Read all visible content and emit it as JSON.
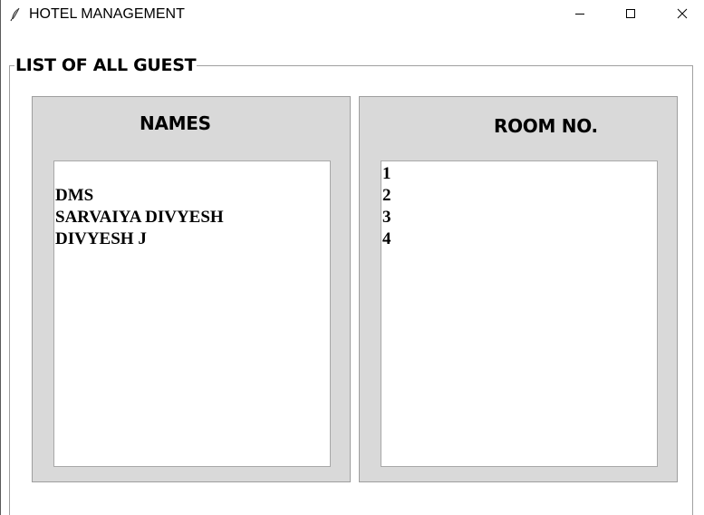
{
  "window": {
    "title": "HOTEL MANAGEMENT",
    "icon": "feather-icon",
    "controls": [
      "minimize-icon",
      "maximize-icon",
      "close-icon"
    ]
  },
  "group": {
    "label": "LIST OF ALL GUEST"
  },
  "names_panel": {
    "header": "NAMES",
    "items": [
      "",
      "DMS",
      "SARVAIYA DIVYESH",
      "DIVYESH J"
    ]
  },
  "rooms_panel": {
    "header": "ROOM NO.",
    "items": [
      "1",
      "2",
      "3",
      "4"
    ]
  },
  "colors": {
    "panel_bg": "#d9d9d9",
    "listbox_bg": "#ffffff",
    "text": "#000000"
  }
}
